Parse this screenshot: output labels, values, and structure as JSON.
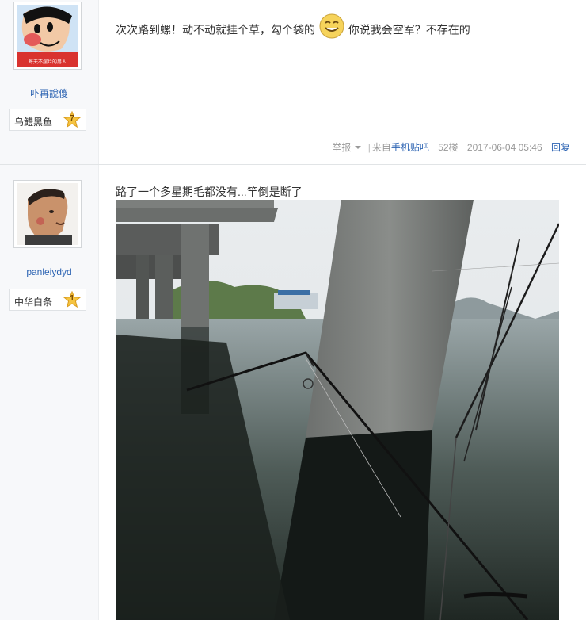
{
  "post1": {
    "author": "卟再說傻",
    "avatar_caption": "每天不摆烂的男人",
    "badge_name": "乌鳢黑鱼",
    "badge_level": "7",
    "text_before": "次次路到螺！动不动就挂个草，勾个袋的",
    "emoticon": "smile-emoticon",
    "text_after": "你说我会空军？不存在的",
    "report_label": "举报",
    "source_label": "来自",
    "source_link": "手机贴吧",
    "floor": "52楼",
    "timestamp": "2017-06-04 05:46",
    "reply_label": "回复"
  },
  "post2": {
    "author": "panleiydyd",
    "badge_name": "中华白条",
    "badge_level": "1",
    "text": "路了一个多星期毛都没有...竿倒是断了",
    "photo": "broken-fishing-rod-under-bridge-photo"
  },
  "colors": {
    "link": "#2d64b3",
    "meta": "#999999",
    "sidebar_bg": "#f7f8fa",
    "badge_star": "#f5c440"
  }
}
